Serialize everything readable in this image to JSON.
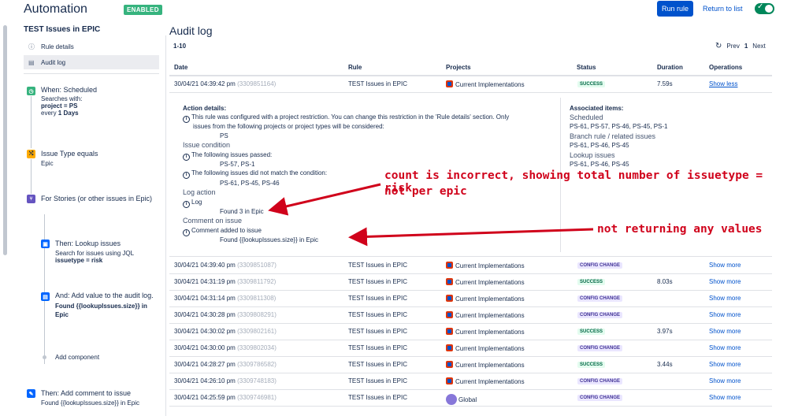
{
  "header": {
    "title": "Automation",
    "status": "ENABLED",
    "run_rule": "Run rule",
    "return_to_list": "Return to list"
  },
  "sidebar": {
    "rule_name": "TEST Issues in EPIC",
    "nav": [
      {
        "label": "Rule details",
        "icon": "info-icon"
      },
      {
        "label": "Audit log",
        "icon": "document-icon"
      }
    ],
    "components": {
      "trigger": {
        "title": "When: Scheduled",
        "line1": "Searches with:",
        "line2_key": "project = PS",
        "line3_pre": "every",
        "line3_strong": "1 Days"
      },
      "condition": {
        "title": "Issue Type equals",
        "value": "Epic"
      },
      "branch": {
        "title": "For Stories (or other issues in Epic)"
      },
      "lookup": {
        "title": "Then: Lookup issues",
        "line1": "Search for issues using JQL",
        "line2": "issuetype = risk"
      },
      "log": {
        "title": "And: Add value to the audit log.",
        "detail": "Found {{lookupIssues.size}} in Epic"
      },
      "add_component": "Add component",
      "comment": {
        "title": "Then: Add comment to issue",
        "detail": "Found {{lookupIssues.size}} in Epic"
      }
    }
  },
  "main": {
    "title": "Audit log",
    "range": "1-10",
    "pager": {
      "prev": "Prev",
      "page": "1",
      "next": "Next"
    },
    "columns": [
      "Date",
      "Rule",
      "Projects",
      "Status",
      "Duration",
      "Operations"
    ],
    "expanded_row": {
      "date": "30/04/21 04:39:42 pm",
      "id": "(3309851164)",
      "rule": "TEST Issues in EPIC",
      "project": "Current Implementations",
      "status": "SUCCESS",
      "duration": "7.59s",
      "op": "Show less"
    },
    "details": {
      "action_details": "Action details:",
      "restriction_1": "This rule was configured with a project restriction. You can change this restriction in the 'Rule details' section. Only",
      "restriction_2": "issues from the following projects or project types will be considered:",
      "restriction_value": "PS",
      "issue_condition": "Issue condition",
      "passed": "The following issues passed:",
      "passed_value": "PS-57, PS-1",
      "not_match": "The following issues did not match the condition:",
      "not_match_value": "PS-61, PS-45, PS-46",
      "log_action": "Log action",
      "log": "Log",
      "log_value": "Found 3 in Epic",
      "comment_on_issue": "Comment on issue",
      "comment_added": "Comment added to issue",
      "comment_value": "Found {{lookupIssues.size}} in Epic",
      "associated": "Associated items:",
      "scheduled": "Scheduled",
      "scheduled_links": "PS-61, PS-57, PS-46, PS-45, PS-1",
      "branch": "Branch rule / related issues",
      "branch_links": "PS-61, PS-46, PS-45",
      "lookup": "Lookup issues",
      "lookup_links": "PS-61, PS-46, PS-45"
    },
    "rows": [
      {
        "date": "30/04/21 04:39:40 pm",
        "id": "(3309851087)",
        "rule": "TEST Issues in EPIC",
        "project": "Current Implementations",
        "status": "CONFIG CHANGE",
        "duration": "",
        "op": "Show more",
        "globe": false
      },
      {
        "date": "30/04/21 04:31:19 pm",
        "id": "(3309811792)",
        "rule": "TEST Issues in EPIC",
        "project": "Current Implementations",
        "status": "SUCCESS",
        "duration": "8.03s",
        "op": "Show more",
        "globe": false
      },
      {
        "date": "30/04/21 04:31:14 pm",
        "id": "(3309811308)",
        "rule": "TEST Issues in EPIC",
        "project": "Current Implementations",
        "status": "CONFIG CHANGE",
        "duration": "",
        "op": "Show more",
        "globe": false
      },
      {
        "date": "30/04/21 04:30:28 pm",
        "id": "(3309808291)",
        "rule": "TEST Issues in EPIC",
        "project": "Current Implementations",
        "status": "CONFIG CHANGE",
        "duration": "",
        "op": "Show more",
        "globe": false
      },
      {
        "date": "30/04/21 04:30:02 pm",
        "id": "(3309802161)",
        "rule": "TEST Issues in EPIC",
        "project": "Current Implementations",
        "status": "SUCCESS",
        "duration": "3.97s",
        "op": "Show more",
        "globe": false
      },
      {
        "date": "30/04/21 04:30:00 pm",
        "id": "(3309802034)",
        "rule": "TEST Issues in EPIC",
        "project": "Current Implementations",
        "status": "CONFIG CHANGE",
        "duration": "",
        "op": "Show more",
        "globe": false
      },
      {
        "date": "30/04/21 04:28:27 pm",
        "id": "(3309786582)",
        "rule": "TEST Issues in EPIC",
        "project": "Current Implementations",
        "status": "SUCCESS",
        "duration": "3.44s",
        "op": "Show more",
        "globe": false
      },
      {
        "date": "30/04/21 04:26:10 pm",
        "id": "(3309748183)",
        "rule": "TEST Issues in EPIC",
        "project": "Current Implementations",
        "status": "CONFIG CHANGE",
        "duration": "",
        "op": "Show more",
        "globe": false
      },
      {
        "date": "30/04/21 04:25:59 pm",
        "id": "(3309746981)",
        "rule": "TEST Issues in EPIC",
        "project": "Global",
        "status": "CONFIG CHANGE",
        "duration": "",
        "op": "Show more",
        "globe": true
      }
    ]
  },
  "annotations": {
    "note1_line1": "count is incorrect, showing total number of issuetype = risk",
    "note1_line2": "not per epic",
    "note2": "not returning any values",
    "color": "#d0021b"
  }
}
